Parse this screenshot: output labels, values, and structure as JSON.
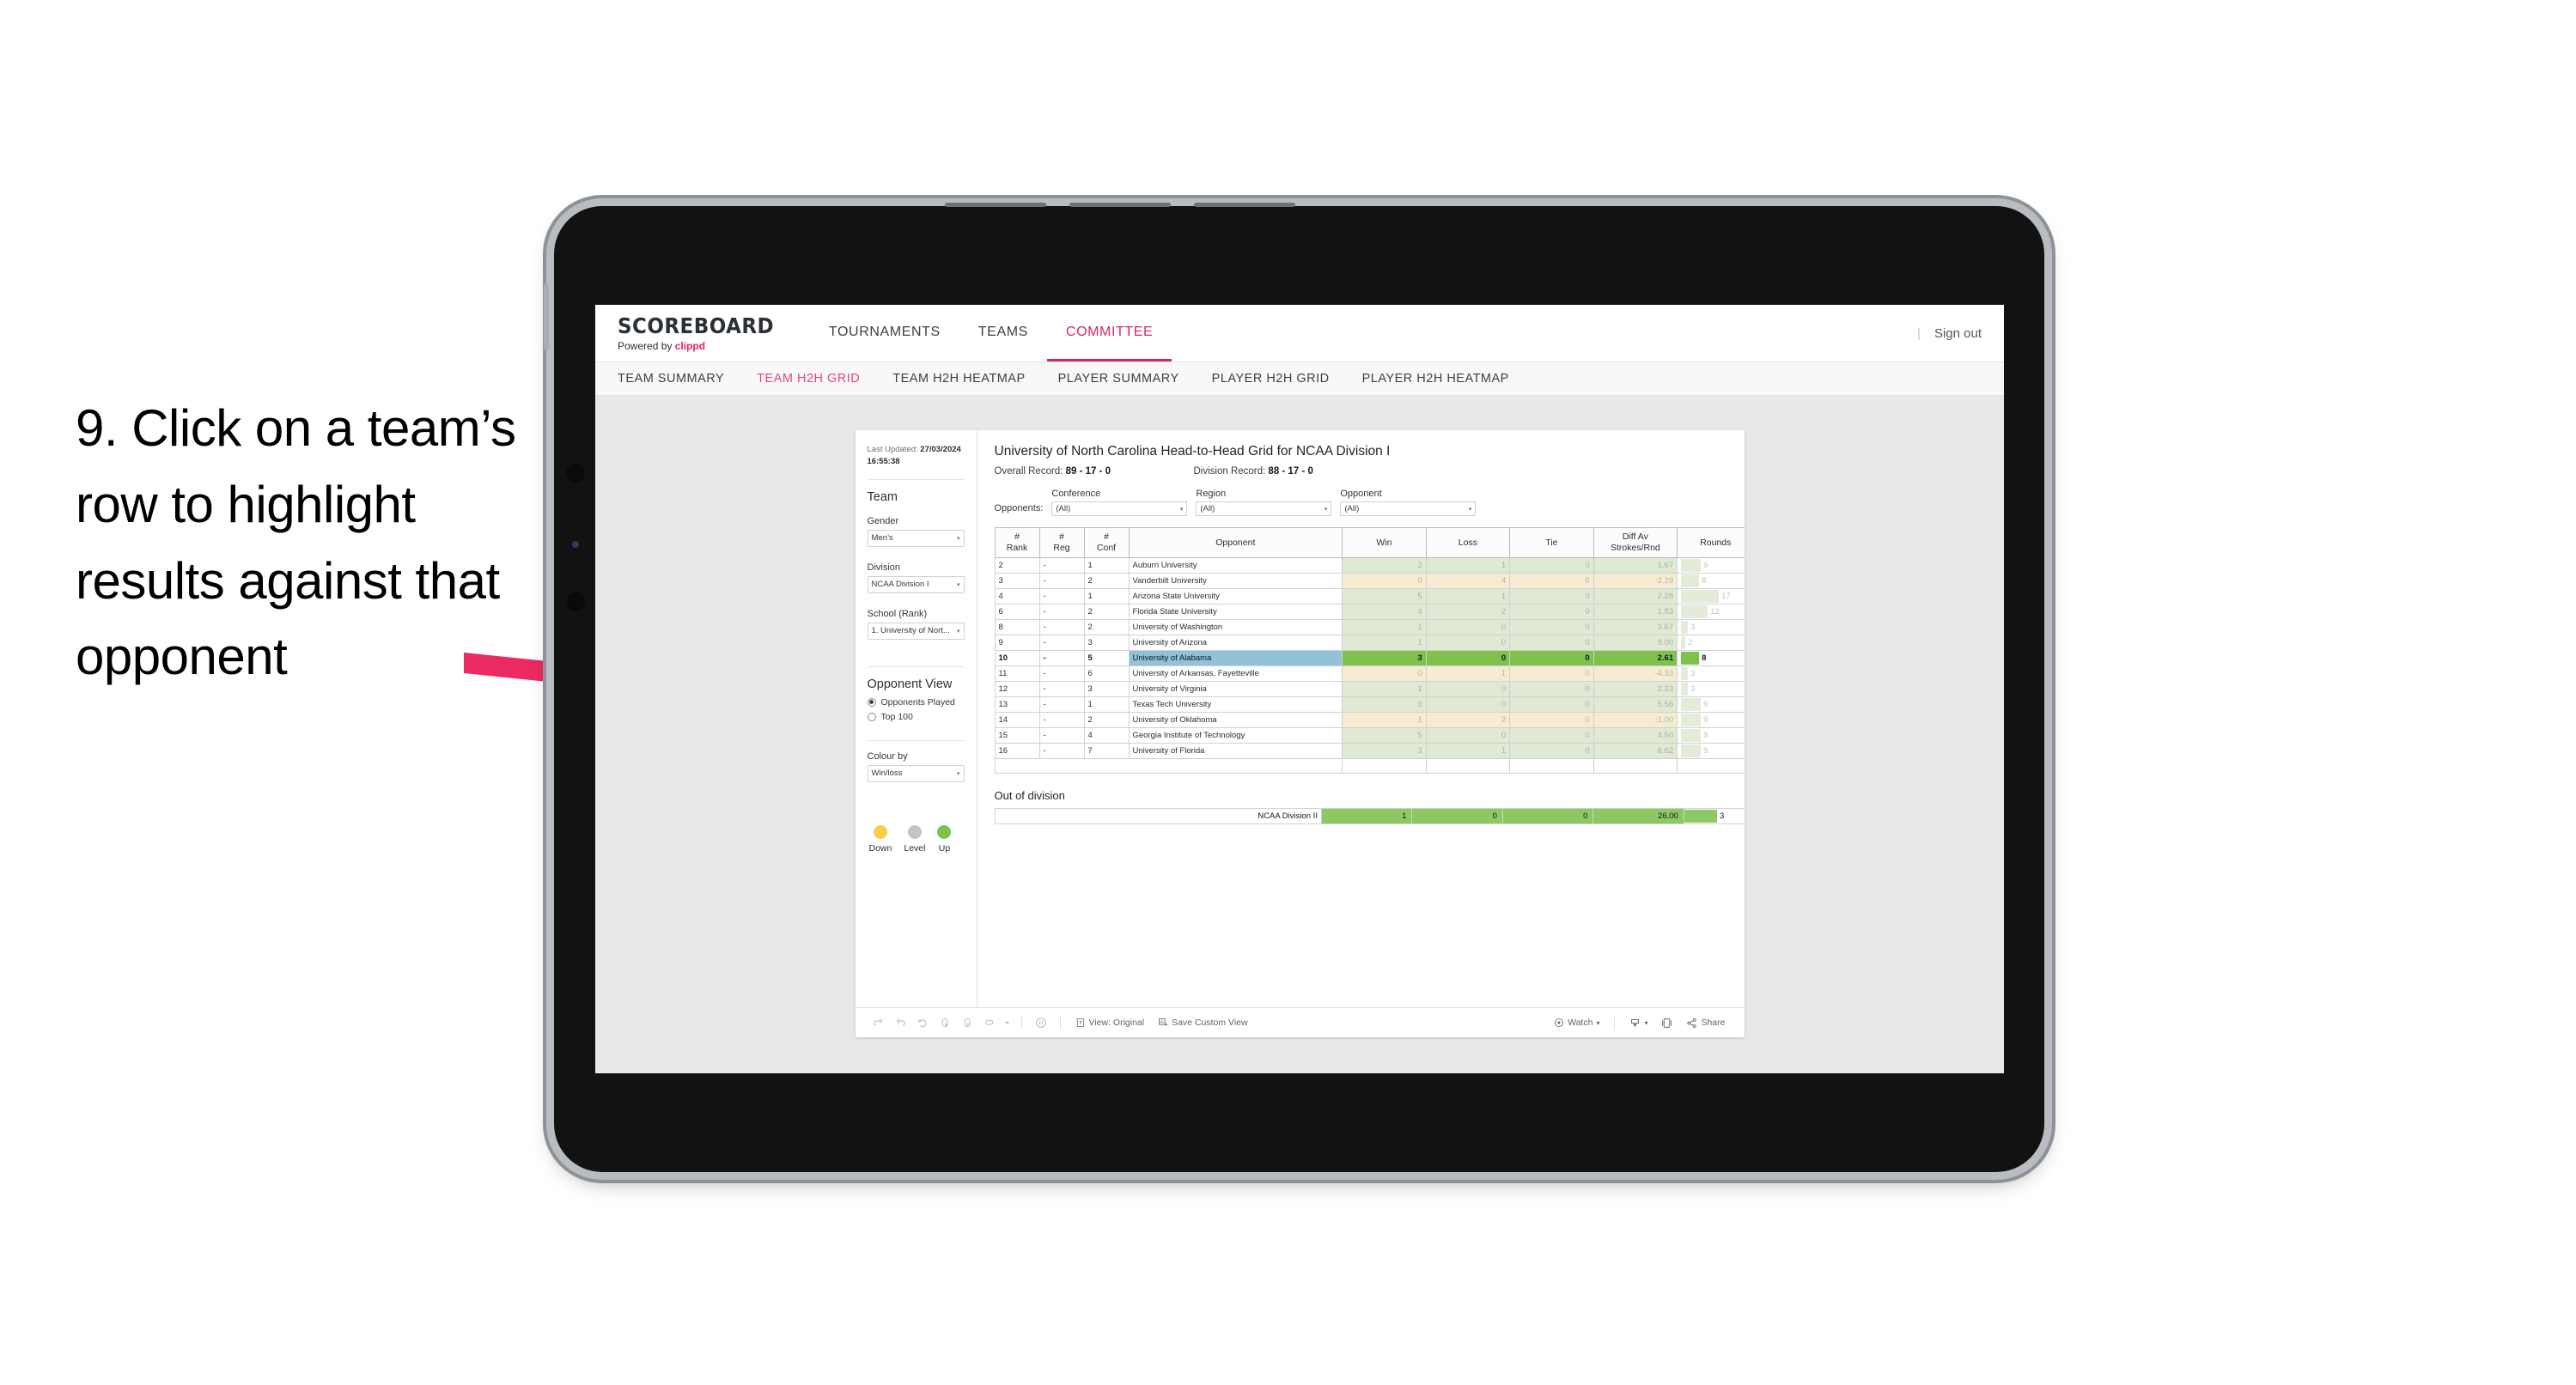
{
  "caption": "9. Click on a team’s row to highlight results against that opponent",
  "topnav": {
    "logo": "SCOREBOARD",
    "powered_prefix": "Powered by ",
    "powered_brand": "clippd",
    "items": [
      {
        "label": "TOURNAMENTS",
        "active": false
      },
      {
        "label": "TEAMS",
        "active": false
      },
      {
        "label": "COMMITTEE",
        "active": true
      }
    ],
    "separator": "|",
    "signout": "Sign out"
  },
  "subnav": {
    "items": [
      {
        "label": "TEAM SUMMARY",
        "active": false
      },
      {
        "label": "TEAM H2H GRID",
        "active": true
      },
      {
        "label": "TEAM H2H HEATMAP",
        "active": false
      },
      {
        "label": "PLAYER SUMMARY",
        "active": false
      },
      {
        "label": "PLAYER H2H GRID",
        "active": false
      },
      {
        "label": "PLAYER H2H HEATMAP",
        "active": false
      }
    ]
  },
  "filters": {
    "last_updated_label": "Last Updated: ",
    "last_updated_value": "27/03/2024 16:55:38",
    "team_heading": "Team",
    "gender_label": "Gender",
    "gender_value": "Men’s",
    "division_label": "Division",
    "division_value": "NCAA Division I",
    "school_label": "School (Rank)",
    "school_value": "1. University of Nort...",
    "opponent_view_heading": "Opponent View",
    "opponent_view_options": [
      {
        "label": "Opponents Played",
        "selected": true
      },
      {
        "label": "Top 100",
        "selected": false
      }
    ],
    "colour_by_label": "Colour by",
    "colour_by_value": "Win/loss",
    "legend": [
      {
        "caption": "Down",
        "color": "#f2d147"
      },
      {
        "caption": "Level",
        "color": "#c2c5c8"
      },
      {
        "caption": "Up",
        "color": "#7ec24b"
      }
    ],
    "caret": "▾"
  },
  "viz": {
    "title": "University of North Carolina Head-to-Head Grid for NCAA Division I",
    "overall_record_label": "Overall Record: ",
    "overall_record_value": "89 - 17 - 0",
    "division_record_label": "Division Record: ",
    "division_record_value": "88 - 17 - 0",
    "opponents_label": "Opponents:",
    "dropdowns": [
      {
        "label": "Conference",
        "value": "(All)"
      },
      {
        "label": "Region",
        "value": "(All)"
      },
      {
        "label": "Opponent",
        "value": "(All)"
      }
    ],
    "caret": "▾"
  },
  "table": {
    "headers": {
      "rank": "#\nRank",
      "rank_l1": "#",
      "rank_l2": "Rank",
      "reg_l1": "#",
      "reg_l2": "Reg",
      "conf_l1": "#",
      "conf_l2": "Conf",
      "opponent": "Opponent",
      "win": "Win",
      "loss": "Loss",
      "tie": "Tie",
      "diff_l1": "Diff Av",
      "diff_l2": "Strokes/Rnd",
      "rounds": "Rounds"
    },
    "max_rounds": 17,
    "rows": [
      {
        "rank": "2",
        "reg": "-",
        "conf": "1",
        "opponent": "Auburn University",
        "win": "2",
        "loss": "1",
        "tie": "0",
        "diff": "1.67",
        "rounds": "9",
        "tone": "up",
        "selected": false
      },
      {
        "rank": "3",
        "reg": "-",
        "conf": "2",
        "opponent": "Vanderbilt University",
        "win": "0",
        "loss": "4",
        "tie": "0",
        "diff": "-2.29",
        "rounds": "8",
        "tone": "down",
        "selected": false
      },
      {
        "rank": "4",
        "reg": "-",
        "conf": "1",
        "opponent": "Arizona State University",
        "win": "5",
        "loss": "1",
        "tie": "0",
        "diff": "2.28",
        "rounds": "17",
        "tone": "up",
        "selected": false
      },
      {
        "rank": "6",
        "reg": "-",
        "conf": "2",
        "opponent": "Florida State University",
        "win": "4",
        "loss": "2",
        "tie": "0",
        "diff": "1.83",
        "rounds": "12",
        "tone": "up",
        "selected": false
      },
      {
        "rank": "8",
        "reg": "-",
        "conf": "2",
        "opponent": "University of Washington",
        "win": "1",
        "loss": "0",
        "tie": "0",
        "diff": "3.67",
        "rounds": "3",
        "tone": "up",
        "selected": false
      },
      {
        "rank": "9",
        "reg": "-",
        "conf": "3",
        "opponent": "University of Arizona",
        "win": "1",
        "loss": "0",
        "tie": "0",
        "diff": "9.00",
        "rounds": "2",
        "tone": "up",
        "selected": false
      },
      {
        "rank": "10",
        "reg": "-",
        "conf": "5",
        "opponent": "University of Alabama",
        "win": "3",
        "loss": "0",
        "tie": "0",
        "diff": "2.61",
        "rounds": "8",
        "tone": "up",
        "selected": true
      },
      {
        "rank": "11",
        "reg": "-",
        "conf": "6",
        "opponent": "University of Arkansas, Fayetteville",
        "win": "0",
        "loss": "1",
        "tie": "0",
        "diff": "-4.33",
        "rounds": "3",
        "tone": "down",
        "selected": false
      },
      {
        "rank": "12",
        "reg": "-",
        "conf": "3",
        "opponent": "University of Virginia",
        "win": "1",
        "loss": "0",
        "tie": "0",
        "diff": "2.33",
        "rounds": "3",
        "tone": "up",
        "selected": false
      },
      {
        "rank": "13",
        "reg": "-",
        "conf": "1",
        "opponent": "Texas Tech University",
        "win": "3",
        "loss": "0",
        "tie": "0",
        "diff": "5.56",
        "rounds": "9",
        "tone": "up",
        "selected": false
      },
      {
        "rank": "14",
        "reg": "-",
        "conf": "2",
        "opponent": "University of Oklahoma",
        "win": "1",
        "loss": "2",
        "tie": "0",
        "diff": "-1.00",
        "rounds": "9",
        "tone": "down",
        "selected": false
      },
      {
        "rank": "15",
        "reg": "-",
        "conf": "4",
        "opponent": "Georgia Institute of Technology",
        "win": "5",
        "loss": "0",
        "tie": "0",
        "diff": "4.50",
        "rounds": "9",
        "tone": "up",
        "selected": false
      },
      {
        "rank": "16",
        "reg": "-",
        "conf": "7",
        "opponent": "University of Florida",
        "win": "3",
        "loss": "1",
        "tie": "0",
        "diff": "6.62",
        "rounds": "9",
        "tone": "up",
        "selected": false
      }
    ]
  },
  "out_of_division": {
    "title": "Out of division",
    "row": {
      "label": "NCAA Division II",
      "win": "1",
      "loss": "0",
      "tie": "0",
      "diff": "26.00",
      "rounds": "3"
    }
  },
  "toolbar": {
    "view_label": "View: Original",
    "save_label": "Save Custom View",
    "watch_label": "Watch",
    "share_label": "Share",
    "caret": "▾"
  },
  "colors": {
    "accent": "#d8275c",
    "selected_row": "#92c1d8",
    "up": "#7ec24b",
    "up_faded": "#dfe9d4",
    "down_faded": "#f5ecd2",
    "rounds_bar": "#7ec24b",
    "rounds_bar_faded": "#e4ecd9"
  },
  "chart_data": {
    "type": "table",
    "title": "University of North Carolina Head-to-Head Grid for NCAA Division I",
    "columns": [
      "# Rank",
      "# Reg",
      "# Conf",
      "Opponent",
      "Win",
      "Loss",
      "Tie",
      "Diff Av Strokes/Rnd",
      "Rounds"
    ],
    "rows": [
      [
        "2",
        "-",
        "1",
        "Auburn University",
        2,
        1,
        0,
        1.67,
        9
      ],
      [
        "3",
        "-",
        "2",
        "Vanderbilt University",
        0,
        4,
        0,
        -2.29,
        8
      ],
      [
        "4",
        "-",
        "1",
        "Arizona State University",
        5,
        1,
        0,
        2.28,
        17
      ],
      [
        "6",
        "-",
        "2",
        "Florida State University",
        4,
        2,
        0,
        1.83,
        12
      ],
      [
        "8",
        "-",
        "2",
        "University of Washington",
        1,
        0,
        0,
        3.67,
        3
      ],
      [
        "9",
        "-",
        "3",
        "University of Arizona",
        1,
        0,
        0,
        9.0,
        2
      ],
      [
        "10",
        "-",
        "5",
        "University of Alabama",
        3,
        0,
        0,
        2.61,
        8
      ],
      [
        "11",
        "-",
        "6",
        "University of Arkansas, Fayetteville",
        0,
        1,
        0,
        -4.33,
        3
      ],
      [
        "12",
        "-",
        "3",
        "University of Virginia",
        1,
        0,
        0,
        2.33,
        3
      ],
      [
        "13",
        "-",
        "1",
        "Texas Tech University",
        3,
        0,
        0,
        5.56,
        9
      ],
      [
        "14",
        "-",
        "2",
        "University of Oklahoma",
        1,
        2,
        0,
        -1.0,
        9
      ],
      [
        "15",
        "-",
        "4",
        "Georgia Institute of Technology",
        5,
        0,
        0,
        4.5,
        9
      ],
      [
        "16",
        "-",
        "7",
        "University of Florida",
        3,
        1,
        0,
        6.62,
        9
      ]
    ],
    "out_of_division": [
      [
        "NCAA Division II",
        1,
        0,
        0,
        26.0,
        3
      ]
    ],
    "overall_record": "89 - 17 - 0",
    "division_record": "88 - 17 - 0",
    "selected_row_index": 6,
    "legend": [
      {
        "label": "Down",
        "color": "#f2d147"
      },
      {
        "label": "Level",
        "color": "#c2c5c8"
      },
      {
        "label": "Up",
        "color": "#7ec24b"
      }
    ]
  }
}
